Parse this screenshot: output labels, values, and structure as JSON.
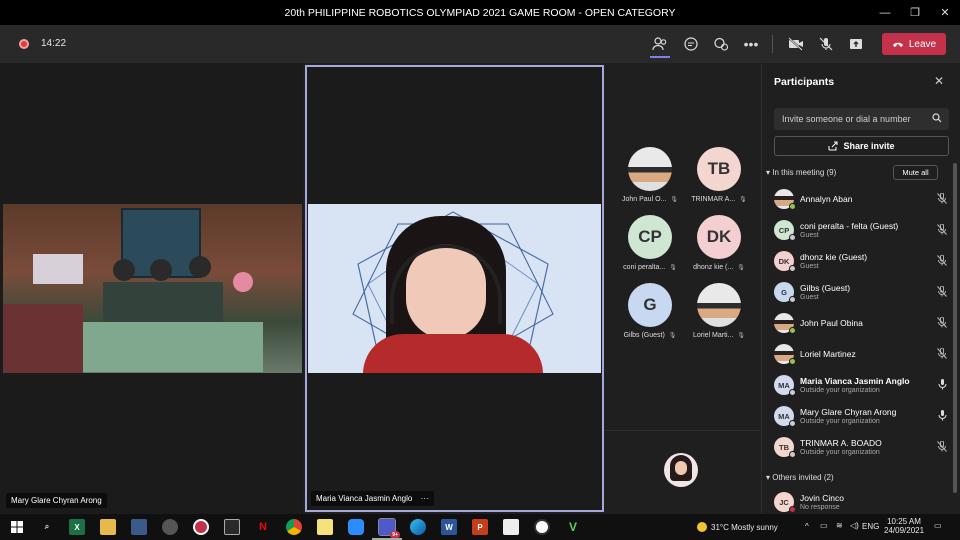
{
  "window": {
    "title": "20th PHILIPPINE ROBOTICS OLYMPIAD 2021 GAME ROOM - OPEN CATEGORY",
    "controls": [
      "—",
      "❐",
      "✕"
    ]
  },
  "toolbar": {
    "timer": "14:22",
    "leave_label": "Leave"
  },
  "tiles": {
    "left_name": "Mary Glare Chyran Arong",
    "center_name": "Maria Vianca Jasmin Anglo",
    "center_more": "···"
  },
  "grid": [
    {
      "initials": "",
      "label": "John Paul O...",
      "color": "#e8e8e8",
      "photo": true
    },
    {
      "initials": "TB",
      "label": "TRINMAR A...",
      "color": "#f3d6cf"
    },
    {
      "initials": "CP",
      "label": "coni peralta...",
      "color": "#cfe6d3"
    },
    {
      "initials": "DK",
      "label": "dhonz kie (...",
      "color": "#f3cfd2"
    },
    {
      "initials": "G",
      "label": "Gilbs (Guest)",
      "color": "#c8d8f0"
    },
    {
      "initials": "",
      "label": "Loriel Marti...",
      "color": "#e8e8e8",
      "photo": true
    }
  ],
  "panel": {
    "title": "Participants",
    "invite_placeholder": "Invite someone or dial a number",
    "share_label": "Share invite",
    "in_meeting": "In this meeting (9)",
    "mute_all": "Mute all",
    "others": "Others invited (2)",
    "people": [
      {
        "initials": "",
        "name": "Annalyn Aban",
        "sub": "",
        "bg": "#f0e6e6",
        "status": "#92c353",
        "mic": "muted",
        "photo": true
      },
      {
        "initials": "CP",
        "name": "coni peralta - felta (Guest)",
        "sub": "Guest",
        "bg": "#cfe6d3",
        "status": "#cccccc",
        "mic": "muted"
      },
      {
        "initials": "DK",
        "name": "dhonz kie (Guest)",
        "sub": "Guest",
        "bg": "#f3cfd2",
        "status": "#cccccc",
        "mic": "muted"
      },
      {
        "initials": "G",
        "name": "Gilbs (Guest)",
        "sub": "Guest",
        "bg": "#c8d8f0",
        "status": "#cccccc",
        "mic": "muted"
      },
      {
        "initials": "",
        "name": "John Paul Obina",
        "sub": "",
        "bg": "#e0e0e0",
        "status": "#92c353",
        "mic": "muted",
        "photo": true
      },
      {
        "initials": "",
        "name": "Loriel Martinez",
        "sub": "",
        "bg": "#e0e0e0",
        "status": "#92c353",
        "mic": "muted",
        "photo": true
      },
      {
        "initials": "MA",
        "name": "Maria Vianca Jasmin Anglo",
        "sub": "Outside your organization",
        "bg": "#d5d9f0",
        "status": "#cccccc",
        "mic": "on",
        "bold": true
      },
      {
        "initials": "MA",
        "name": "Mary Glare Chyran Arong",
        "sub": "Outside your organization",
        "bg": "#d5d9f0",
        "status": "#cccccc",
        "mic": "on"
      },
      {
        "initials": "TB",
        "name": "TRINMAR A. BOADO",
        "sub": "Outside your organization",
        "bg": "#f3d6cf",
        "status": "#cccccc",
        "mic": "muted"
      },
      {
        "initials": "JC",
        "name": "Jovin Cinco",
        "sub": "No response",
        "bg": "#f3d6cf",
        "status": "#c4314b",
        "mic": "none"
      }
    ]
  },
  "taskbar": {
    "weather": "31°C  Mostly sunny",
    "lang": "ENG",
    "time": "10:25 AM",
    "date": "24/09/2021",
    "badge": "9+"
  }
}
